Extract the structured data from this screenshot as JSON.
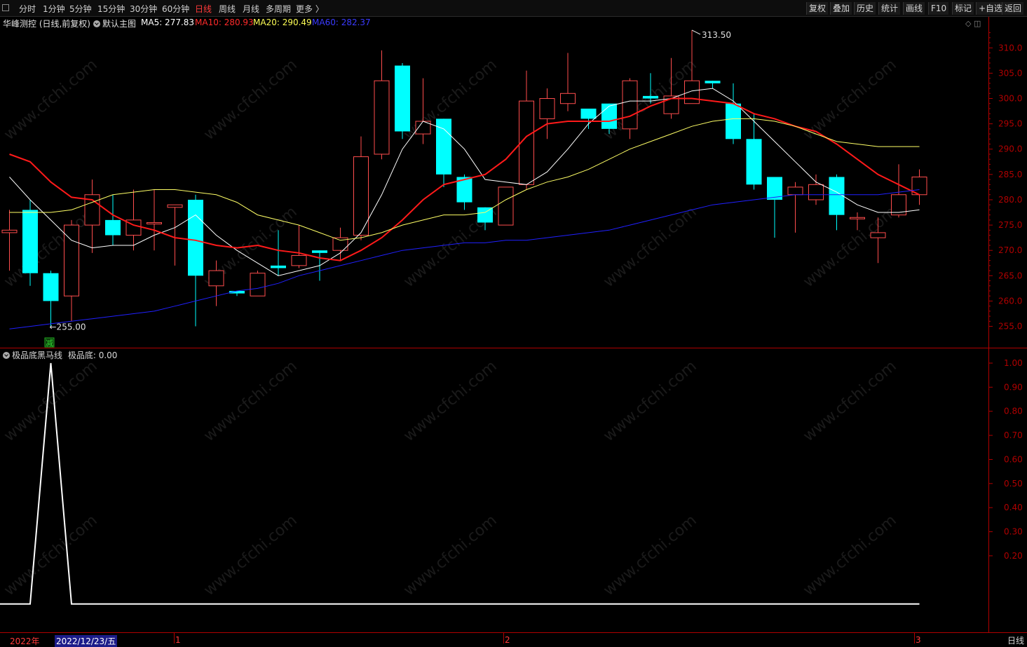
{
  "toolbar": {
    "periods": [
      "分时",
      "1分钟",
      "5分钟",
      "15分钟",
      "30分钟",
      "60分钟",
      "日线",
      "周线",
      "月线",
      "多周期",
      "更多 〉"
    ],
    "active_period": "日线",
    "right_buttons": [
      "复权",
      "叠加",
      "历史",
      "统计",
      "画线",
      "F10",
      "标记",
      "+自选",
      "返回"
    ]
  },
  "legend": {
    "stock": "华峰测控 (日线,前复权)",
    "template": "默认主图",
    "ma5": "MA5: 277.83",
    "ma10": "MA10: 280.93",
    "ma20": "MA20: 290.49",
    "ma60": "MA60: 282.37"
  },
  "colors": {
    "up": "#ff4d4d",
    "down": "#00ffff",
    "ma5": "#ffffff",
    "ma10": "#ff1a1a",
    "ma20": "#ffff66",
    "ma60": "#2020ff",
    "axis": "#b00000"
  },
  "indicator": {
    "name": "极品底黑马线",
    "value_label": "极品底: 0.00",
    "signal_label": "减"
  },
  "bottom": {
    "dates": [
      "2022年",
      "2022/12/23/五",
      "1",
      "2",
      "3"
    ],
    "tab": "日线"
  },
  "watermark": "www.cfchi.com",
  "chart_data": [
    {
      "type": "candlestick",
      "yaxis_ticks": [
        255,
        260,
        265,
        270,
        275,
        280,
        285,
        290,
        295,
        300,
        305,
        310
      ],
      "ylim": [
        253,
        313.5
      ],
      "annotations": {
        "high": "313.50",
        "low": "←255.00"
      },
      "candles": [
        [
          273.5,
          274.0,
          278.0,
          266.0
        ],
        [
          278.0,
          265.5,
          280.0,
          263.0
        ],
        [
          265.5,
          260.0,
          266.0,
          255.0
        ],
        [
          261.0,
          275.0,
          276.0,
          256.0
        ],
        [
          275.0,
          281.0,
          284.0,
          269.5
        ],
        [
          276.0,
          273.0,
          281.0,
          271.0
        ],
        [
          273.0,
          276.0,
          282.0,
          270.0
        ],
        [
          275.5,
          275.5,
          282.0,
          270.0
        ],
        [
          278.5,
          279.0,
          279.0,
          267.0
        ],
        [
          280.0,
          265.0,
          281.0,
          255.0
        ],
        [
          263.0,
          266.0,
          268.0,
          259.0
        ],
        [
          262.0,
          261.5,
          262.0,
          261.0
        ],
        [
          261.0,
          265.5,
          266.0,
          261.0
        ],
        [
          267.0,
          266.5,
          274.0,
          265.0
        ],
        [
          267.0,
          269.0,
          275.0,
          266.5
        ],
        [
          270.0,
          269.5,
          270.0,
          264.0
        ],
        [
          270.0,
          272.5,
          274.5,
          268.0
        ],
        [
          273.0,
          288.5,
          292.5,
          272.0
        ],
        [
          289.0,
          303.5,
          309.5,
          288.0
        ],
        [
          306.5,
          293.5,
          307.0,
          292.0
        ],
        [
          293.0,
          295.5,
          304.0,
          291.0
        ],
        [
          296.0,
          285.0,
          296.0,
          282.5
        ],
        [
          284.5,
          279.5,
          285.0,
          278.0
        ],
        [
          278.5,
          275.5,
          278.5,
          274.0
        ],
        [
          275.0,
          282.5,
          282.0,
          275.0
        ],
        [
          283.0,
          299.5,
          305.5,
          282.0
        ],
        [
          296.0,
          300.0,
          302.0,
          292.0
        ],
        [
          299.0,
          301.0,
          309.0,
          297.5
        ],
        [
          298.0,
          296.0,
          298.0,
          294.0
        ],
        [
          299.0,
          294.0,
          299.0,
          293.0
        ],
        [
          294.0,
          303.5,
          304.0,
          292.0
        ],
        [
          300.5,
          300.0,
          305.0,
          299.0
        ],
        [
          297.0,
          300.5,
          308.0,
          296.0
        ],
        [
          299.0,
          303.5,
          313.5,
          299.0
        ],
        [
          303.5,
          303.0,
          303.5,
          302.0
        ],
        [
          299.0,
          292.0,
          303.0,
          291.0
        ],
        [
          292.0,
          283.0,
          297.0,
          282.0
        ],
        [
          284.5,
          280.0,
          284.5,
          272.5
        ],
        [
          281.0,
          282.5,
          283.5,
          273.5
        ],
        [
          280.0,
          283.0,
          285.0,
          279.0
        ],
        [
          284.5,
          277.0,
          285.0,
          274.0
        ],
        [
          276.5,
          276.5,
          277.5,
          274.0
        ],
        [
          272.5,
          273.5,
          276.5,
          267.5
        ],
        [
          277.0,
          281.0,
          287.0,
          276.5
        ],
        [
          281.0,
          284.5,
          286.0,
          279.0
        ]
      ],
      "series": [
        {
          "name": "MA5",
          "values": [
            284.5,
            280.0,
            276.0,
            272.0,
            270.5,
            271.0,
            271.0,
            273.0,
            274.5,
            277.0,
            273.0,
            270.0,
            267.5,
            265.0,
            266.0,
            267.0,
            269.5,
            273.5,
            281.0,
            290.0,
            295.5,
            294.0,
            290.0,
            284.0,
            283.5,
            283.0,
            285.5,
            290.0,
            295.0,
            298.5,
            299.5,
            299.5,
            300.0,
            301.5,
            302.0,
            299.5,
            295.5,
            291.5,
            287.5,
            283.5,
            281.5,
            279.0,
            277.5,
            277.5,
            278.0
          ]
        },
        {
          "name": "MA10",
          "values": [
            289.0,
            287.5,
            283.5,
            280.5,
            280.0,
            277.0,
            275.0,
            274.0,
            272.5,
            272.0,
            271.0,
            270.5,
            271.0,
            270.0,
            269.5,
            268.5,
            268.0,
            270.0,
            272.5,
            276.0,
            280.0,
            283.0,
            284.0,
            285.0,
            288.0,
            292.5,
            295.0,
            295.5,
            295.5,
            295.5,
            296.5,
            298.5,
            300.0,
            300.0,
            299.5,
            299.0,
            297.0,
            296.0,
            294.5,
            293.5,
            291.0,
            288.0,
            285.0,
            283.0,
            281.0
          ]
        },
        {
          "name": "MA20",
          "values": [
            277.5,
            277.5,
            277.5,
            278.0,
            279.5,
            281.0,
            281.5,
            282.0,
            282.0,
            281.5,
            281.0,
            279.5,
            277.0,
            276.0,
            275.0,
            273.5,
            272.0,
            272.5,
            273.5,
            275.0,
            276.0,
            277.0,
            277.0,
            277.5,
            280.0,
            282.0,
            283.5,
            284.5,
            286.0,
            288.0,
            290.0,
            291.5,
            293.0,
            294.5,
            295.5,
            296.0,
            296.0,
            295.5,
            294.5,
            293.0,
            291.5,
            291.0,
            290.5,
            290.5,
            290.5
          ]
        },
        {
          "name": "MA60",
          "values": [
            254.5,
            255.0,
            255.5,
            256.0,
            256.5,
            257.0,
            257.5,
            258.0,
            259.0,
            260.0,
            261.0,
            262.0,
            262.5,
            263.5,
            265.0,
            266.0,
            267.0,
            268.0,
            269.0,
            270.0,
            270.5,
            271.0,
            271.5,
            271.5,
            272.0,
            272.0,
            272.5,
            273.0,
            273.5,
            274.0,
            275.0,
            276.0,
            277.0,
            278.0,
            279.0,
            279.5,
            280.0,
            280.5,
            281.0,
            281.0,
            281.0,
            281.0,
            281.0,
            281.5,
            282.0
          ]
        }
      ]
    },
    {
      "type": "line",
      "title": "极品底黑马线",
      "yaxis_ticks": [
        0.2,
        0.3,
        0.4,
        0.5,
        0.6,
        0.7,
        0.8,
        0.9,
        1.0
      ],
      "ylim": [
        -0.1,
        1.0
      ],
      "series": [
        {
          "name": "极品底",
          "values": [
            0,
            0,
            1,
            0,
            0,
            0,
            0,
            0,
            0,
            0,
            0,
            0,
            0,
            0,
            0,
            0,
            0,
            0,
            0,
            0,
            0,
            0,
            0,
            0,
            0,
            0,
            0,
            0,
            0,
            0,
            0,
            0,
            0,
            0,
            0,
            0,
            0,
            0,
            0,
            0,
            0,
            0,
            0,
            0,
            0
          ]
        }
      ]
    }
  ]
}
